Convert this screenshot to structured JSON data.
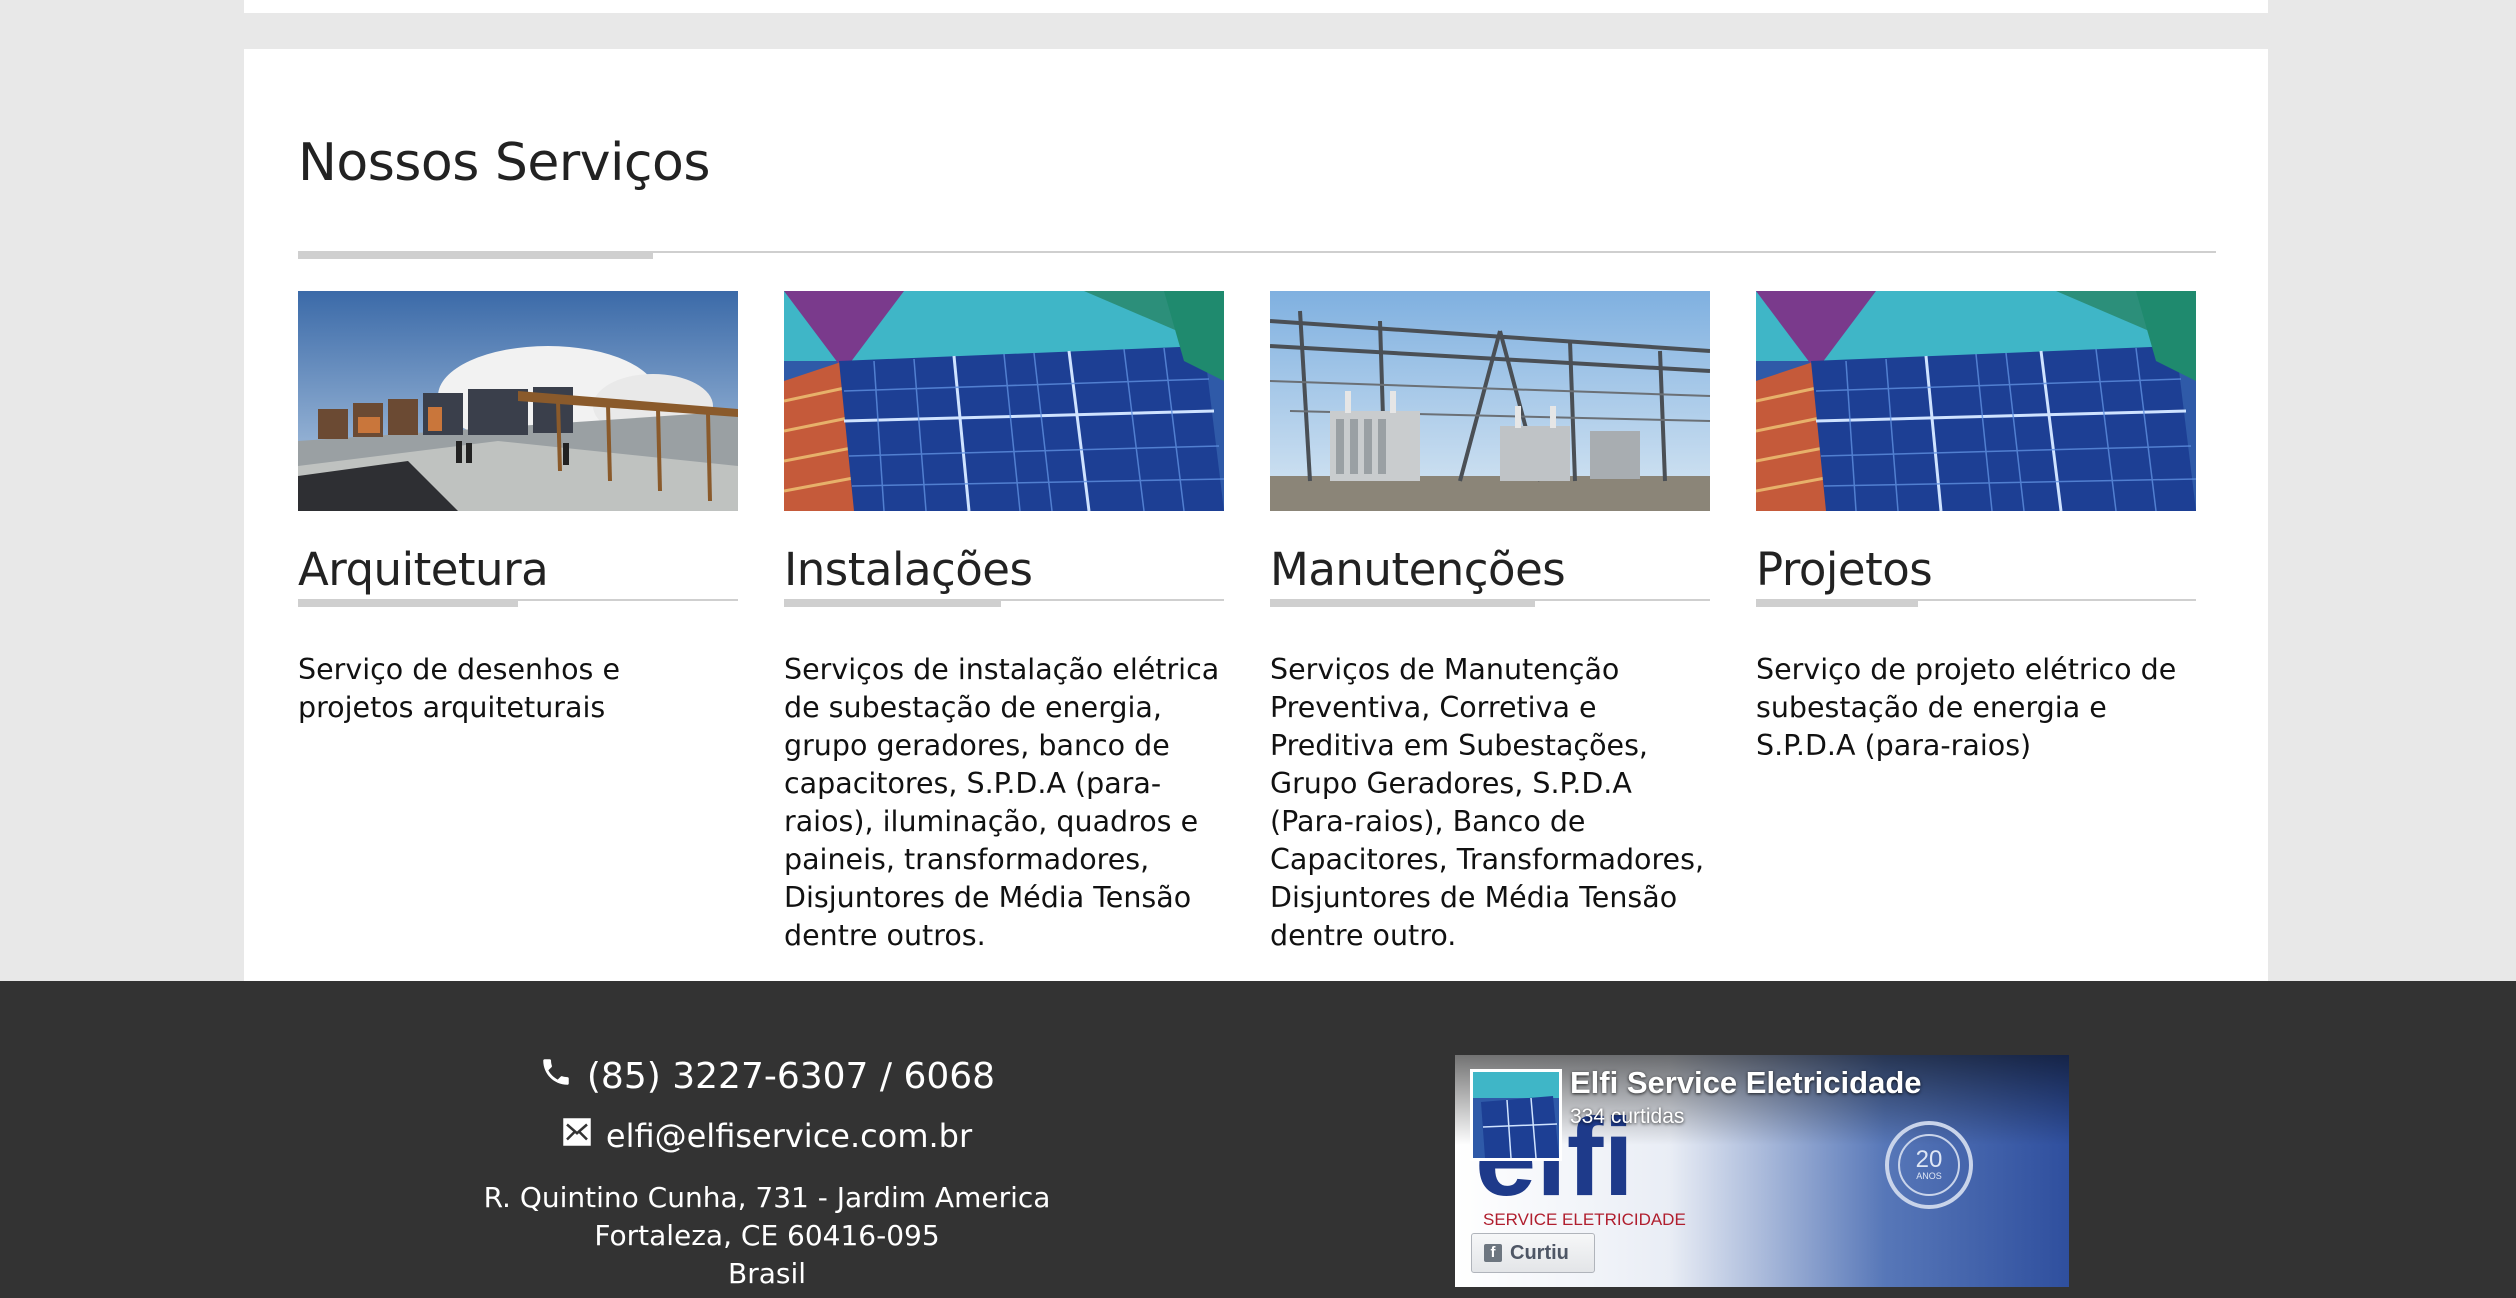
{
  "section": {
    "title": "Nossos Serviços"
  },
  "services": [
    {
      "title": "Arquitetura",
      "image": "architecture-render-image",
      "description": "Serviço de desenhos e projetos arquiteturais"
    },
    {
      "title": "Instalações",
      "image": "solar-panels-image",
      "description": "Serviços de instalação elétrica de subestação de energia, grupo geradores, banco de capacitores, S.P.D.A (para-raios), iluminação, quadros e paineis, transformadores, Disjuntores de Média Tensão dentre outros."
    },
    {
      "title": "Manutenções",
      "image": "substation-image",
      "description": "Serviços de Manutenção Preventiva, Corretiva e Preditiva em Subestações, Grupo Geradores, S.P.D.A (Para-raios), Banco de Capacitores, Transformadores, Disjuntores de Média Tensão dentre outro."
    },
    {
      "title": "Projetos",
      "image": "solar-panels-image",
      "description": "Serviço de projeto elétrico de subestação de energia e S.P.D.A (para-raios)"
    }
  ],
  "footer": {
    "phone": "(85) 3227-6307 / 6068",
    "email": "elfi@elfiservice.com.br",
    "address": [
      "R. Quintino Cunha, 731 - Jardim America",
      "Fortaleza, CE 60416-095",
      "Brasil"
    ],
    "phone_icon": "phone-icon",
    "email_icon": "envelope-icon"
  },
  "facebook": {
    "page_name": "Elfi Service Eletricidade",
    "likes": "334 curtidas",
    "like_button": "Curtiu",
    "cover_logo_text": "elfi",
    "cover_tagline": "SERVICE ELETRICIDADE",
    "cover_badge_number": "20",
    "cover_badge_word": "ANOS"
  },
  "colors": {
    "page_bg": "#e8e8e8",
    "panel_bg": "#ffffff",
    "footer_bg": "#333333",
    "rule": "#cfcfcf",
    "facebook_blue": "#3b5998"
  }
}
